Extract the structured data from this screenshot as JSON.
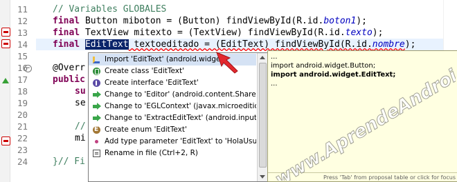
{
  "editor": {
    "line_numbers": [
      "11",
      "12",
      "13",
      "14",
      "15",
      "16",
      "17",
      "18",
      "19",
      "20",
      "21",
      "22",
      "23",
      "24"
    ],
    "lines": {
      "l11": "// Variables GLOBALES",
      "l12_kw": "final",
      "l12_a": " Button miboton = (Button) findViewById(R.id.",
      "l12_b": "boton1",
      "l12_c": ");",
      "l13_kw": "final",
      "l13_a": " TextView mitexto = (TextView) findViewById(R.id.",
      "l13_b": "texto",
      "l13_c": ");",
      "l14_kw": "final",
      "l14_sel": "EditText",
      "l14_a": " textoeditado = (EditText) findViewById(R.id.",
      "l14_b": "nombre",
      "l14_c": ");",
      "l16": "@Overr",
      "l17": "public",
      "l18": "su",
      "l19": "se",
      "l21": "//",
      "l22": "mi",
      "l24": "}// Fi"
    }
  },
  "proposals": {
    "items": [
      {
        "icon": "import-icon",
        "label": "Import 'EditText' (android.widget)"
      },
      {
        "icon": "create-class-icon",
        "label": "Create class 'EditText'"
      },
      {
        "icon": "create-interface-icon",
        "label": "Create interface 'EditText'"
      },
      {
        "icon": "change-icon",
        "label": "Change to 'Editor' (android.content.SharedPre"
      },
      {
        "icon": "change-icon",
        "label": "Change to 'EGLContext' (javax.microedition.kh"
      },
      {
        "icon": "change-icon",
        "label": "Change to 'ExtractEditText' (android.inputmet"
      },
      {
        "icon": "create-enum-icon",
        "label": "Create enum 'EditText'"
      },
      {
        "icon": "add-type-parameter-icon",
        "label": "Add type parameter 'EditText' to 'HolaUsuario'"
      },
      {
        "icon": "rename-icon",
        "label": "Rename in file (Ctrl+2, R)"
      }
    ]
  },
  "preview": {
    "line1": "...",
    "line2": "import android.widget.Button;",
    "line3": "import android.widget.EditText;",
    "line4": "...",
    "status": "Press 'Tab' from proposal table or click for focus"
  },
  "watermark": "www.AprendeAndroid.com",
  "colors": {
    "keyword": "#7f0055",
    "comment": "#3f7f5f",
    "field": "#0000c0",
    "selection": "#0a246a",
    "error": "#ff0000"
  }
}
